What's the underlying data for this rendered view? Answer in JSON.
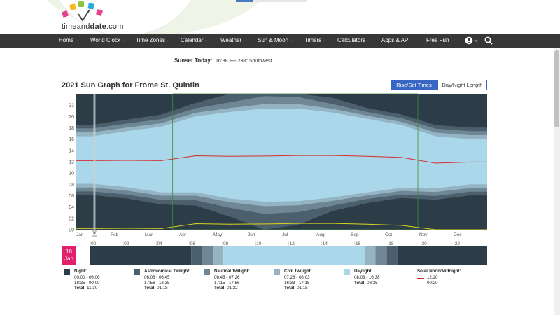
{
  "header": {
    "logo_text_a": "timeand",
    "logo_text_b": "date",
    "logo_text_c": ".com"
  },
  "nav": [
    {
      "label": "Home",
      "caret": "⌄"
    },
    {
      "label": "World Clock",
      "caret": "⌄"
    },
    {
      "label": "Time Zones",
      "caret": "⌄"
    },
    {
      "label": "Calendar",
      "caret": "⌄"
    },
    {
      "label": "Weather",
      "caret": "⌄"
    },
    {
      "label": "Sun & Moon",
      "caret": "⌄"
    },
    {
      "label": "Timers",
      "caret": "⌄"
    },
    {
      "label": "Calculators",
      "caret": "⌄"
    },
    {
      "label": "Apps & API",
      "caret": "⌄"
    },
    {
      "label": "Free Fun",
      "caret": "⌄"
    }
  ],
  "icons": {
    "account": "account-icon",
    "search": "search-icon"
  },
  "sunset": {
    "label": "Sunset Today:",
    "value": "16:38 ⟵ 238° Southwest"
  },
  "chart_title": "2021 Sun Graph for Frome St. Quintin",
  "buttons": {
    "rise_set": "Rise/Set Times",
    "day_night": "Day/Night Length"
  },
  "chart_data": {
    "type": "area",
    "title": "2021 Sun Graph for Frome St. Quintin",
    "x_months": [
      "Jan",
      "Feb",
      "Mar",
      "Apr",
      "May",
      "Jun",
      "Jul",
      "Aug",
      "Sep",
      "Oct",
      "Nov",
      "Dec"
    ],
    "y_ticks": [
      "00",
      "02",
      "04",
      "06",
      "08",
      "10",
      "12",
      "14",
      "16",
      "18",
      "20",
      "22"
    ],
    "ylim": [
      0,
      24
    ],
    "colors": {
      "night": "#2c3d47",
      "astronomical": "#4b5f6c",
      "nautical": "#6f8694",
      "civil": "#94b4c4",
      "daylight": "#aad8ea",
      "solar_noon": "#d62d2d",
      "solar_midnight": "#d9d423",
      "dst_border": "#3c8c3c",
      "today_marker": "#c8d0d6"
    },
    "series_hours_by_month": {
      "sunrise": [
        8.1,
        7.5,
        6.6,
        6.6,
        5.5,
        4.95,
        5.05,
        5.7,
        6.6,
        7.4,
        7.3,
        8.0
      ],
      "sunset": [
        16.5,
        17.4,
        18.2,
        20.0,
        20.8,
        21.4,
        21.4,
        20.7,
        19.6,
        18.5,
        16.5,
        16.0
      ],
      "civil_dawn": [
        7.45,
        6.9,
        6.0,
        6.0,
        4.85,
        4.15,
        4.3,
        5.1,
        6.05,
        6.85,
        6.65,
        7.35
      ],
      "civil_dusk": [
        17.2,
        18.05,
        18.8,
        20.65,
        21.5,
        22.2,
        22.2,
        21.35,
        20.15,
        19.05,
        17.15,
        16.7
      ],
      "nautical_dawn": [
        6.75,
        6.2,
        5.25,
        5.2,
        3.85,
        2.8,
        3.1,
        4.25,
        5.4,
        6.2,
        5.95,
        6.7
      ],
      "nautical_dusk": [
        17.9,
        18.75,
        19.55,
        21.45,
        22.5,
        23.6,
        23.4,
        22.2,
        20.8,
        19.7,
        17.85,
        17.4
      ],
      "astro_dawn": [
        6.1,
        5.5,
        4.45,
        4.25,
        2.3,
        0.0,
        0.9,
        3.3,
        4.7,
        5.6,
        5.3,
        6.05
      ],
      "astro_dusk": [
        18.55,
        19.45,
        20.35,
        22.4,
        24.0,
        24.0,
        24.0,
        23.3,
        21.5,
        20.35,
        18.5,
        18.05
      ],
      "solar_noon": [
        12.2,
        12.25,
        12.2,
        13.05,
        12.95,
        13.0,
        13.1,
        13.1,
        12.95,
        12.75,
        11.75,
        11.95
      ],
      "solar_midnight": [
        0.2,
        0.25,
        0.2,
        1.05,
        0.95,
        1.0,
        1.1,
        1.1,
        0.95,
        0.75,
        -0.25,
        -0.05
      ]
    },
    "dst_start_month_fraction": 2.83,
    "dst_end_month_fraction": 9.98,
    "today": {
      "day": "18",
      "month": "Jan",
      "month_fraction": 0.55
    },
    "timeline": {
      "hour_ticks": [
        "00",
        "02",
        "04",
        "06",
        "08",
        "10",
        "12",
        "14",
        "16",
        "18",
        "20",
        "22"
      ],
      "segments": [
        {
          "from": 0,
          "to": 6.1,
          "kind": "night"
        },
        {
          "from": 6.1,
          "to": 6.75,
          "kind": "astronomical"
        },
        {
          "from": 6.75,
          "to": 7.45,
          "kind": "nautical"
        },
        {
          "from": 7.45,
          "to": 8.05,
          "kind": "civil"
        },
        {
          "from": 8.05,
          "to": 16.63,
          "kind": "daylight"
        },
        {
          "from": 16.63,
          "to": 17.25,
          "kind": "civil"
        },
        {
          "from": 17.25,
          "to": 17.93,
          "kind": "nautical"
        },
        {
          "from": 17.93,
          "to": 18.58,
          "kind": "astronomical"
        },
        {
          "from": 18.58,
          "to": 24,
          "kind": "night"
        }
      ]
    }
  },
  "legend": [
    {
      "title": "Night:",
      "l1": "00:00 - 06:06",
      "l2": "18:35 - 00:00",
      "total_label": "Total:",
      "total": "11:30",
      "color": "#2c3d47"
    },
    {
      "title": "Astronomical Twilight:",
      "l1": "06:06 - 06:45",
      "l2": "17:56 - 18:35",
      "total_label": "Total:",
      "total": "01:18",
      "color": "#4b5f6c"
    },
    {
      "title": "Nautical Twilight:",
      "l1": "06:45 - 07:26",
      "l2": "17:15 - 17:56",
      "total_label": "Total:",
      "total": "01:22",
      "color": "#6f8694"
    },
    {
      "title": "Civil Twilight:",
      "l1": "07:26 - 08:03",
      "l2": "16:38 - 17:15",
      "total_label": "Total:",
      "total": "01:15",
      "color": "#94b4c4"
    },
    {
      "title": "Daylight:",
      "l1": "08:03 - 16:38",
      "l2": "",
      "total_label": "Total:",
      "total": "08:35",
      "color": "#aad8ea"
    },
    {
      "title": "Solar Noon/Midnight:",
      "l1": "12:20",
      "l2": "00:20",
      "total_label": "",
      "total": "",
      "color": ""
    }
  ]
}
